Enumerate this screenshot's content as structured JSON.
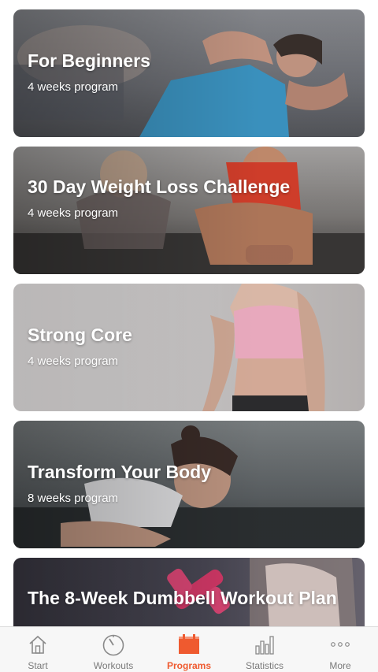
{
  "programs": [
    {
      "title": "For Beginners",
      "subtitle": "4 weeks program"
    },
    {
      "title": "30 Day Weight Loss Challenge",
      "subtitle": "4 weeks program"
    },
    {
      "title": "Strong Core",
      "subtitle": "4 weeks program"
    },
    {
      "title": "Transform Your Body",
      "subtitle": "8 weeks program"
    },
    {
      "title": "The 8-Week Dumbbell Workout Plan",
      "subtitle": ""
    }
  ],
  "tabs": [
    {
      "label": "Start",
      "icon": "home-icon",
      "active": false
    },
    {
      "label": "Workouts",
      "icon": "timer-icon",
      "active": false
    },
    {
      "label": "Programs",
      "icon": "calendar-icon",
      "active": true
    },
    {
      "label": "Statistics",
      "icon": "bar-chart-icon",
      "active": false
    },
    {
      "label": "More",
      "icon": "more-dots-icon",
      "active": false
    }
  ],
  "colors": {
    "accent": "#ef5a2f",
    "tab_inactive": "#7a7a7a"
  }
}
